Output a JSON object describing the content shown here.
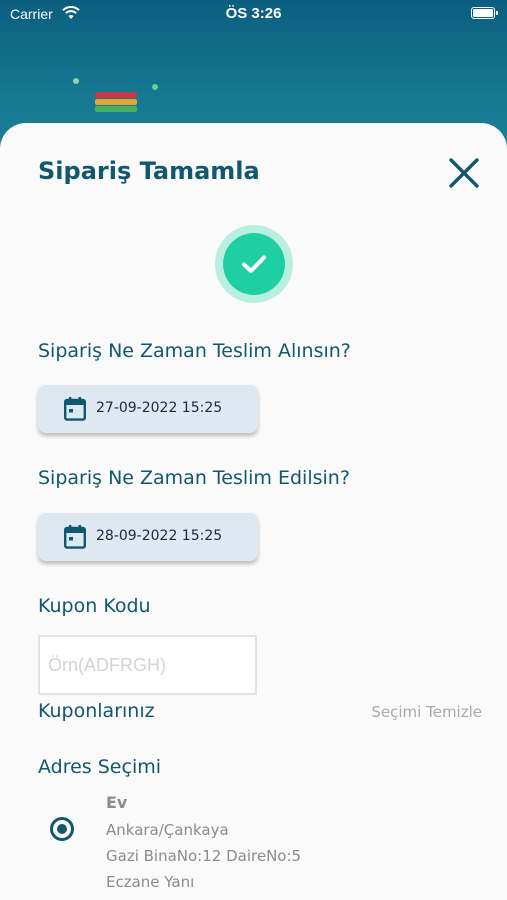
{
  "status_bar": {
    "carrier": "Carrier",
    "time": "ÖS 3:26"
  },
  "sheet": {
    "title": "Sipariş Tamamla"
  },
  "pickup": {
    "label": "Sipariş Ne Zaman Teslim Alınsın?",
    "value": "27-09-2022 15:25"
  },
  "delivery": {
    "label": "Sipariş Ne Zaman Teslim Edilsin?",
    "value": "28-09-2022 15:25"
  },
  "coupon": {
    "label": "Kupon Kodu",
    "placeholder": "Örn(ADFRGH)",
    "value": "",
    "my_coupons_label": "Kuponlarınız",
    "clear_label": "Seçimi Temizle"
  },
  "address": {
    "section_label": "Adres Seçimi",
    "selected": true,
    "name": "Ev",
    "line1": "Ankara/Çankaya",
    "line2": "Gazi BinaNo:12 DaireNo:5",
    "line3": "Eczane Yanı"
  },
  "colors": {
    "primary": "#11576f",
    "success": "#1fcfa4",
    "header_bg": "#0f6f8a"
  },
  "icons": [
    "wifi-icon",
    "battery-icon",
    "close-icon",
    "check-icon",
    "calendar-icon",
    "radio-selected-icon"
  ]
}
